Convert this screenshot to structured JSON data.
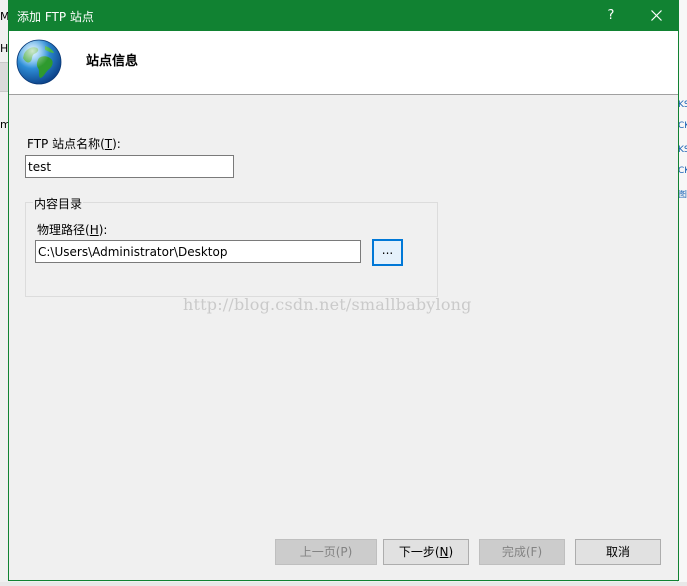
{
  "dialog": {
    "title": "添加 FTP 站点",
    "help_label": "?",
    "header_title": "站点信息"
  },
  "form": {
    "site_name_label_prefix": "FTP 站点名称(",
    "site_name_label_key": "T",
    "site_name_label_suffix": "):",
    "site_name_value": "test",
    "content_dir_legend": "内容目录",
    "physical_path_label_prefix": "物理路径(",
    "physical_path_label_key": "H",
    "physical_path_label_suffix": "):",
    "physical_path_value": "C:\\Users\\Administrator\\Desktop",
    "browse_label": "..."
  },
  "buttons": {
    "prev_label": "上一页(P)",
    "next_label_prefix": "下一步(",
    "next_label_key": "N",
    "next_label_suffix": ")",
    "finish_label": "完成(F)",
    "cancel_label": "取消"
  },
  "background": {
    "left_chars": [
      "M",
      "H",
      "m"
    ],
    "right_links": [
      "KS",
      "CK",
      "KS",
      "CK",
      "图"
    ]
  },
  "watermark": "http://blog.csdn.net/smallbabylong",
  "colors": {
    "titlebar": "#118232",
    "focus_border": "#0078d7",
    "link": "#1a62b5"
  }
}
